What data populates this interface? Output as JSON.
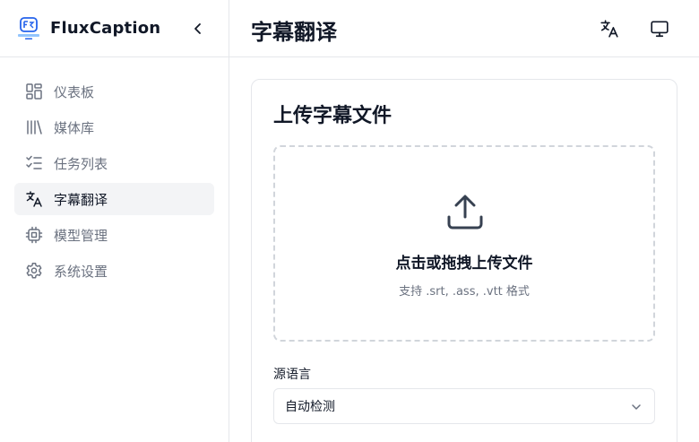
{
  "brand": {
    "name": "FluxCaption",
    "logo_icon": "fluxcaption-logo-icon"
  },
  "sidebar": {
    "collapse_icon": "chevron-left-icon",
    "items": [
      {
        "label": "仪表板",
        "icon": "dashboard-grid-icon",
        "active": false
      },
      {
        "label": "媒体库",
        "icon": "library-icon",
        "active": false
      },
      {
        "label": "任务列表",
        "icon": "task-list-icon",
        "active": false
      },
      {
        "label": "字幕翻译",
        "icon": "translate-icon",
        "active": true
      },
      {
        "label": "模型管理",
        "icon": "cpu-chip-icon",
        "active": false
      },
      {
        "label": "系统设置",
        "icon": "gear-icon",
        "active": false
      }
    ]
  },
  "header": {
    "title": "字幕翻译",
    "language_icon": "translate-icon",
    "theme_icon": "monitor-icon"
  },
  "card": {
    "title": "上传字幕文件",
    "dropzone": {
      "icon": "upload-icon",
      "title": "点击或拖拽上传文件",
      "hint": "支持 .srt, .ass, .vtt 格式"
    },
    "source_language": {
      "label": "源语言",
      "value": "自动检测"
    }
  },
  "colors": {
    "active_bg": "#f3f4f6",
    "border": "#e5e7eb",
    "muted_text": "#6b7280",
    "logo_blue": "#2563eb"
  }
}
